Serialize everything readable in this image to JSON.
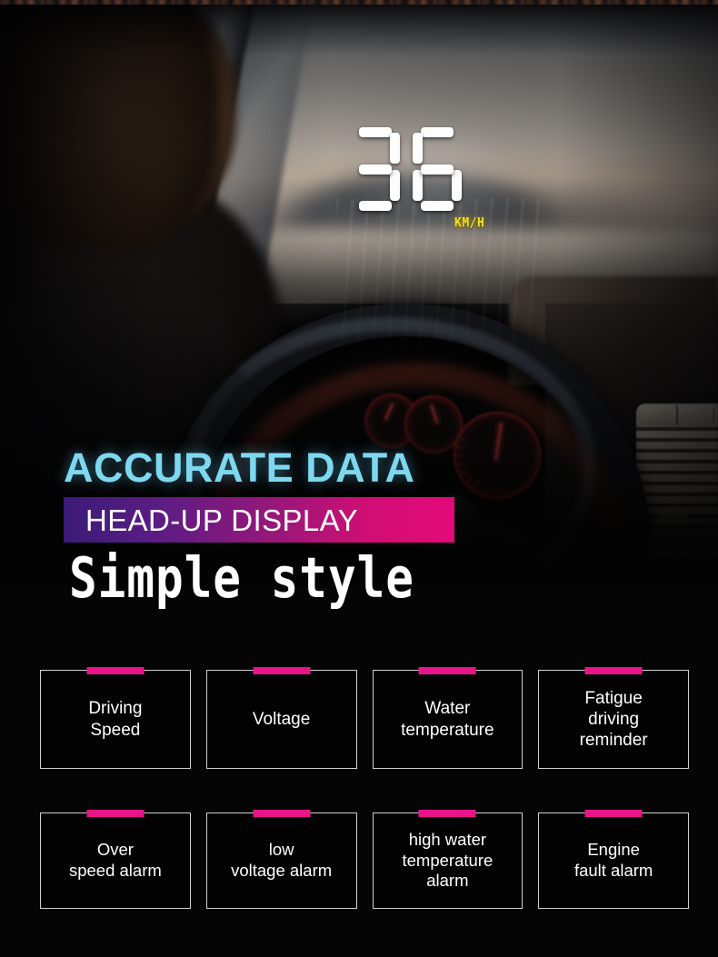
{
  "hud": {
    "speed": "36",
    "unit": "KM/H",
    "unit_color": "#f2e21a"
  },
  "headlines": {
    "line1": "ACCURATE DATA",
    "line1_color": "#7ed8ef",
    "line2": "HEAD-UP DISPLAY",
    "line2_color": "#ffffff",
    "line3": "Simple style",
    "bar_gradient_from": "#3b1b77",
    "bar_gradient_to": "#e30a77"
  },
  "features": {
    "accent_color": "#e8158a",
    "border_color": "#cfcfcf",
    "row1": [
      {
        "label": "Driving\nSpeed"
      },
      {
        "label": "Voltage"
      },
      {
        "label": "Water\ntemperature"
      },
      {
        "label": "Fatigue\ndriving\nreminder"
      }
    ],
    "row2": [
      {
        "label": "Over\nspeed alarm"
      },
      {
        "label": "low\nvoltage alarm"
      },
      {
        "label": "high water\ntemperature\nalarm"
      },
      {
        "label": "Engine\nfault alarm"
      }
    ]
  }
}
